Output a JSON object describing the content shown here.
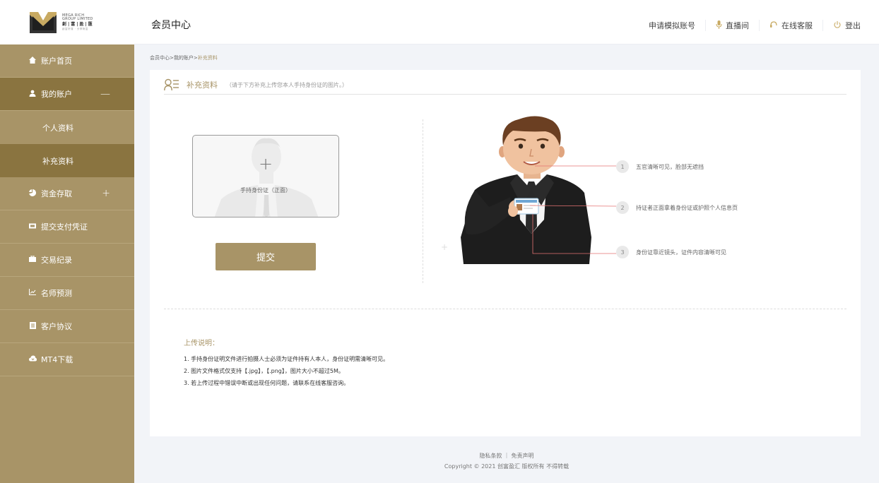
{
  "logo": {
    "line1": "MEGA RICH",
    "line2": "GROUP LIMITED",
    "cn": "創|富|盈|匯",
    "tiny": "創富好運 · 分享財富"
  },
  "header": {
    "title": "会员中心",
    "links": [
      {
        "label": "申请模拟账号",
        "icon": ""
      },
      {
        "label": "直播间",
        "icon": "microphone-icon"
      },
      {
        "label": "在线客服",
        "icon": "headset-icon"
      },
      {
        "label": "登出",
        "icon": "power-icon"
      }
    ]
  },
  "sidebar": {
    "items": [
      {
        "label": "账户首页",
        "icon": "home-icon"
      },
      {
        "label": "我的账户",
        "icon": "user-icon",
        "suffix": "—"
      },
      {
        "label": "个人资料"
      },
      {
        "label": "补充资料"
      },
      {
        "label": "资金存取",
        "icon": "pie-chart-icon",
        "suffix": "+"
      },
      {
        "label": "提交支付凭证",
        "icon": "ticket-icon"
      },
      {
        "label": "交易纪录",
        "icon": "briefcase-icon"
      },
      {
        "label": "名师预测",
        "icon": "line-chart-icon"
      },
      {
        "label": "客户协议",
        "icon": "document-icon"
      },
      {
        "label": "MT4下载",
        "icon": "cloud-download-icon"
      }
    ]
  },
  "breadcrumb": {
    "path": "会员中心>我的账户>",
    "current": "补充资料"
  },
  "panel": {
    "title": "补充资料",
    "note": "（请于下方补充上传您本人手持身份证的图片。）",
    "upload_label": "手持身份证（正面）",
    "plus": "+",
    "submit": "提交",
    "requirements": [
      {
        "num": "1",
        "text": "五官清晰可见，脸部无遮挡"
      },
      {
        "num": "2",
        "text": "持证者正面拿着身份证或护照个人信息页"
      },
      {
        "num": "3",
        "text": "身份证靠近镜头，证件内容清晰可见"
      }
    ],
    "notes_title": "上传说明：",
    "notes": [
      "1. 手持身份证明文件进行拍摄人士必须为证件持有人本人，身份证明需清晰可见。",
      "2. 图片文件格式仅支持【.jpg】，【.png】，图片大小不超过5M。",
      "3. 若上传过程中错误中断或出现任何问题，请联系在线客服咨询。"
    ]
  },
  "footer": {
    "links": "隐私条款 ｜ 免责声明",
    "copyright": "Copyright © 2021 创富盈汇 版权所有 不得转载"
  },
  "colors": {
    "brand_gold": "#a89467",
    "brand_gold_dark": "#8a7440",
    "guide_line": "#e57373"
  }
}
